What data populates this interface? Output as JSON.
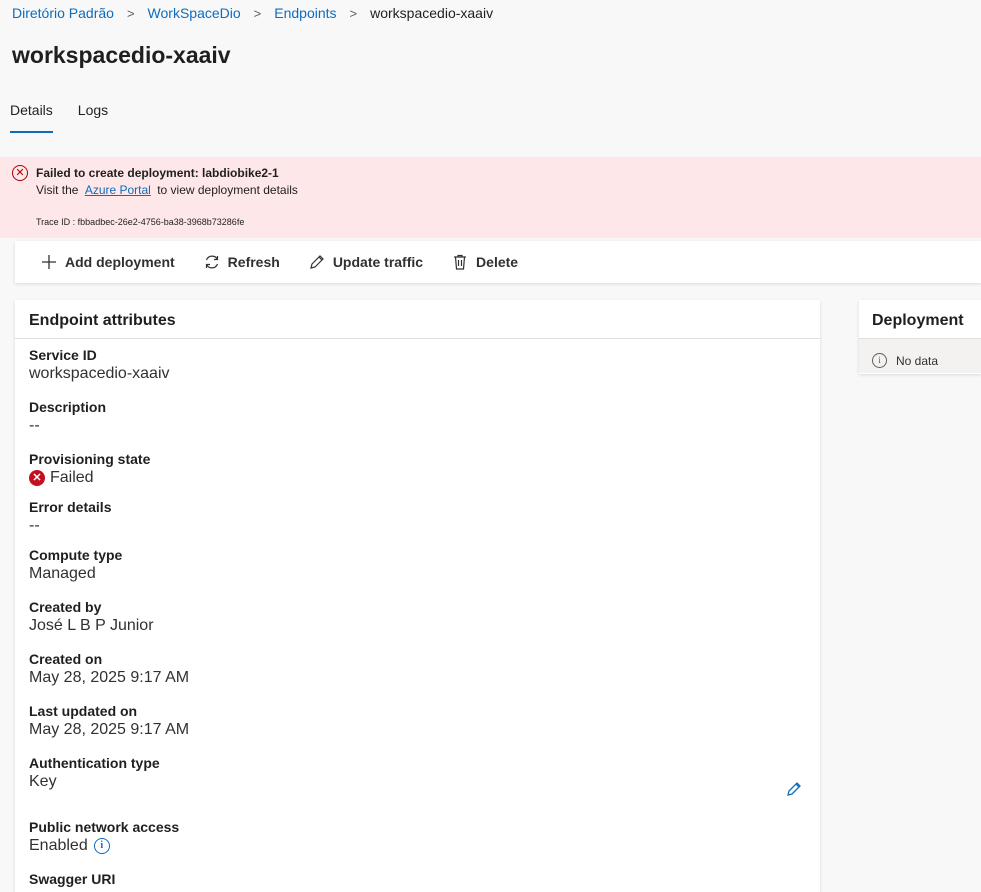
{
  "breadcrumb": {
    "items": [
      "Diretório Padrão",
      "WorkSpaceDio",
      "Endpoints"
    ],
    "current": "workspacedio-xaaiv",
    "separator": ">"
  },
  "page": {
    "title": "workspacedio-xaaiv"
  },
  "tabs": [
    {
      "label": "Details",
      "active": true
    },
    {
      "label": "Logs",
      "active": false
    }
  ],
  "error": {
    "icon": "error-circle-icon",
    "title": "Failed to create deployment: labdiobike2-1",
    "prefix": "Visit the",
    "link": "Azure Portal",
    "suffix": "to view deployment details",
    "trace": "Trace ID : fbbadbec-26e2-4756-ba38-3968b73286fe"
  },
  "toolbar": {
    "add_label": "Add deployment",
    "refresh_label": "Refresh",
    "update_label": "Update traffic",
    "delete_label": "Delete"
  },
  "attributes": {
    "title": "Endpoint attributes",
    "items": [
      {
        "label": "Service ID",
        "value": "workspacedio-xaaiv"
      },
      {
        "label": "Description",
        "value": "--"
      },
      {
        "label": "Provisioning state",
        "value": "Failed"
      },
      {
        "label": "Error details",
        "value": "--"
      },
      {
        "label": "Compute type",
        "value": "Managed"
      },
      {
        "label": "Created by",
        "value": "José L B P Junior"
      },
      {
        "label": "Created on",
        "value": "May 28, 2025 9:17 AM"
      },
      {
        "label": "Last updated on",
        "value": "May 28, 2025 9:17 AM"
      },
      {
        "label": "Authentication type",
        "value": "Key"
      },
      {
        "label": "Public network access",
        "value": "Enabled"
      },
      {
        "label": "Swagger URI",
        "value": ""
      }
    ]
  },
  "deployment": {
    "title": "Deployment",
    "empty_text": "No data"
  },
  "colors": {
    "accent": "#0f6cbd",
    "error_bg": "#fde7e9",
    "error": "#c50f1f"
  }
}
